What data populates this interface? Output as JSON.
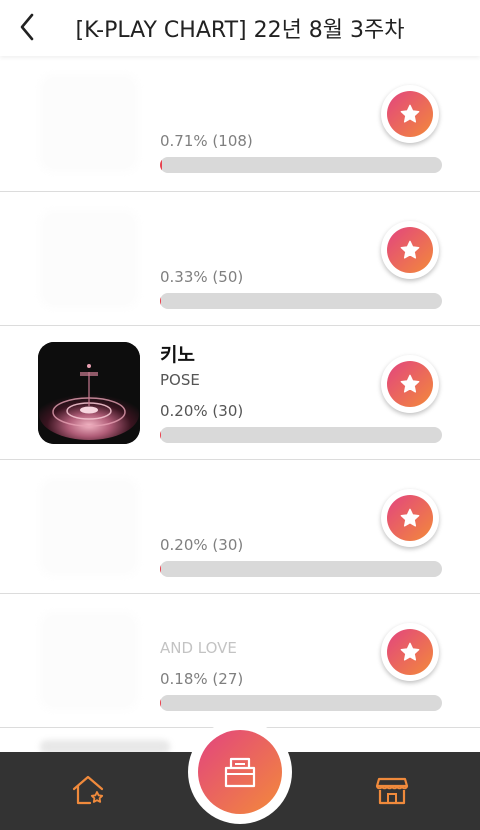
{
  "header": {
    "title": "[K-PLAY CHART] 22년 8월 3주차",
    "back_icon": "chevron-left-icon"
  },
  "rows": [
    {
      "song": "",
      "artist": "",
      "percent_text": "0.71% (108)",
      "fill": 0.71,
      "faded": true
    },
    {
      "song": "",
      "artist": "",
      "percent_text": "0.33% (50)",
      "fill": 0.33,
      "faded": true
    },
    {
      "song": "키노",
      "artist": "POSE",
      "percent_text": "0.20% (30)",
      "fill": 0.2,
      "faded": false
    },
    {
      "song": "",
      "artist": "",
      "percent_text": "0.20% (30)",
      "fill": 0.2,
      "faded": true
    },
    {
      "song": "",
      "artist": "AND LOVE",
      "percent_text": "0.18% (27)",
      "fill": 0.18,
      "faded": true
    }
  ],
  "vote_icon": "star-icon",
  "bottom_nav": {
    "left_icon": "home-star-icon",
    "center_icon": "ballot-box-icon",
    "right_icon": "store-icon"
  },
  "colors": {
    "accent_start": "#e2447f",
    "accent_end": "#f38a3a",
    "bar_fill": "#e8424f",
    "bar_track": "#d9d9d9",
    "nav_bg": "#333333",
    "nav_icon": "#f08a3c"
  }
}
